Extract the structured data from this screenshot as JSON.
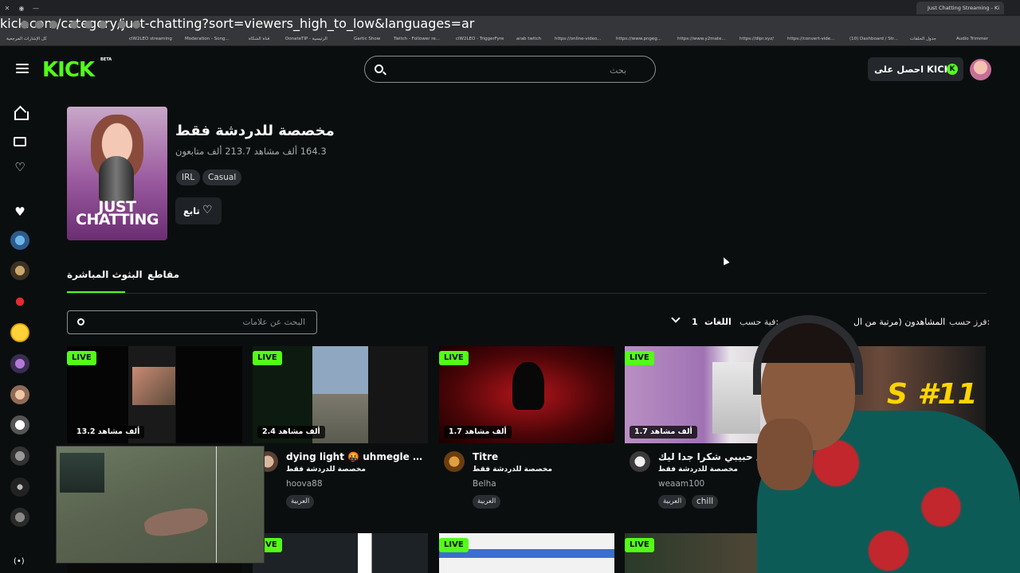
{
  "browser": {
    "tab_title": "Just Chatting Streaming - Ki",
    "url": "kick.com/category/just-chatting?sort=viewers_high_to_low&languages=ar",
    "bookmarks": [
      "كل الإشارات المرجعية",
      "clW2LEO streaming",
      "Moderation - Song...",
      "قناة الشكاة",
      "DonateTIP - الرئيسية",
      "Gartic Show",
      "Twitch - Follower re...",
      "clW2LEO - TriggerFyre",
      "arab twitch",
      "https://online-video...",
      "https://www.pngeg...",
      "https://www.y2mate...",
      "https://dlpr.xyz/",
      "https://convert-vide...",
      "(10) Dashboard / Str...",
      "جدول الحلقات",
      "Audio Trimmer"
    ]
  },
  "header": {
    "logo": "KICK",
    "logo_badge": "BETA",
    "search_placeholder": "بحث",
    "get_kicks_label": "احصل على KICKs",
    "kicks_coin": "K"
  },
  "sidebar": {
    "live_icon": "(•)"
  },
  "category": {
    "cover_text": "JUST CHATTING",
    "title": "مخصصة للدردشة فقط",
    "stats": "164.3 ألف مشاهد   213.7 ألف متابعون",
    "tags": [
      "IRL",
      "Casual"
    ],
    "follow_label": "تابع",
    "follow_icon": "♡"
  },
  "tabs": {
    "live": "البثوث المباشرة",
    "clips": "مقاطع"
  },
  "filters": {
    "tag_search_placeholder": "البحث عن علامات",
    "languages_label": "اللغات",
    "languages_count": "1",
    "filter_by_label": "فية حسب:",
    "sort_value": "المشاهدون (مرتبة من ال",
    "sort_by_label": "فرز حسب:"
  },
  "streams": [
    {
      "live": "LIVE",
      "viewers": "13.2 ألف مشاهد",
      "title": "",
      "category": "",
      "username": "",
      "tags": []
    },
    {
      "live": "LIVE",
      "viewers": "2.4 ألف مشاهد",
      "title": "dying light 🤬 uhmegle 🤣 ...",
      "category": "مخصصة للدردشة فقط",
      "username": "hoova88",
      "tags": [
        "العربية"
      ]
    },
    {
      "live": "LIVE",
      "viewers": "1.7 ألف مشاهد",
      "title": "Titre",
      "category": "مخصصة للدردشة فقط",
      "username": "Belha",
      "tags": [
        "العربية"
      ]
    },
    {
      "live": "LIVE",
      "viewers": "1.7 ألف مشاهد",
      "title": "2 مع حبيبي شكرا جدا ليك",
      "category": "مخصصة للدردشة فقط",
      "username": "weaam100",
      "tags": [
        "العربية",
        "chill"
      ]
    },
    {
      "live": "",
      "viewers": "",
      "title": "",
      "category": "",
      "username": "",
      "tags": [],
      "thumb_text": "S #11"
    }
  ],
  "streams_row2": [
    {
      "live": ""
    },
    {
      "live": "LIVE"
    },
    {
      "live": "LIVE"
    },
    {
      "live": "LIVE"
    }
  ],
  "colors": {
    "brand_green": "#53fc18",
    "background": "#0b0e0f"
  }
}
